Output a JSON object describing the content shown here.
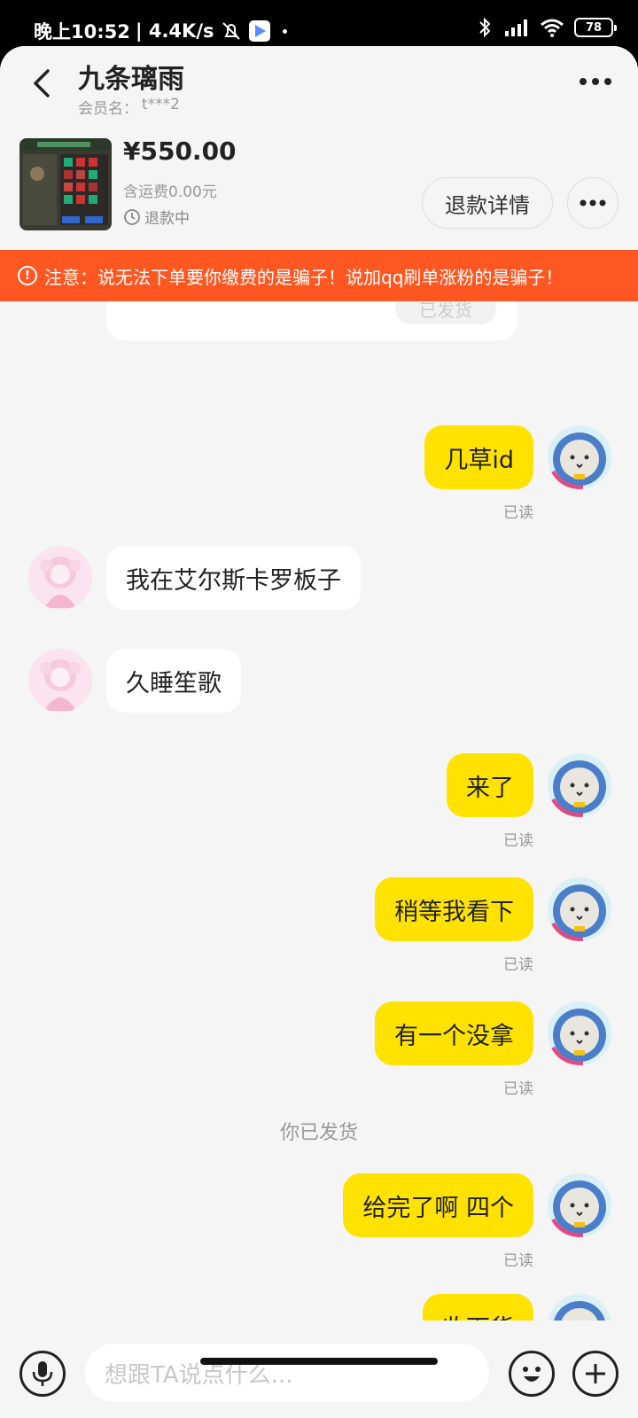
{
  "status_bar": {
    "time": "晚上10:52",
    "speed": "| 4.4K/s",
    "battery": "78"
  },
  "header": {
    "title": "九条璃雨",
    "member_label": "会员名：",
    "member_name": "t***2"
  },
  "order": {
    "price": "¥550.00",
    "shipping": "含运费0.00元",
    "status": "退款中",
    "refund_button": "退款详情"
  },
  "warning": {
    "text": "注意：说无法下单要你缴费的是骗子！说加qq刷单涨粉的是骗子！"
  },
  "prev_card": {
    "pill": "已发货"
  },
  "messages": [
    {
      "from": "me",
      "text": "几草id",
      "read": "已读"
    },
    {
      "from": "other",
      "text": "我在艾尔斯卡罗板子"
    },
    {
      "from": "other",
      "text": "久睡笙歌"
    },
    {
      "from": "me",
      "text": "来了",
      "read": "已读"
    },
    {
      "from": "me",
      "text": "稍等我看下",
      "read": "已读"
    },
    {
      "from": "me",
      "text": "有一个没拿",
      "read": "已读"
    },
    {
      "from": "me",
      "text": "给完了啊 四个",
      "read": "已读"
    },
    {
      "from": "me",
      "text": "收下货"
    }
  ],
  "system_message": "你已发货",
  "input": {
    "placeholder": "想跟TA说点什么..."
  },
  "colors": {
    "accent_yellow": "#ffe200",
    "warning_orange": "#ff5722",
    "background": "#f5f5f5"
  }
}
